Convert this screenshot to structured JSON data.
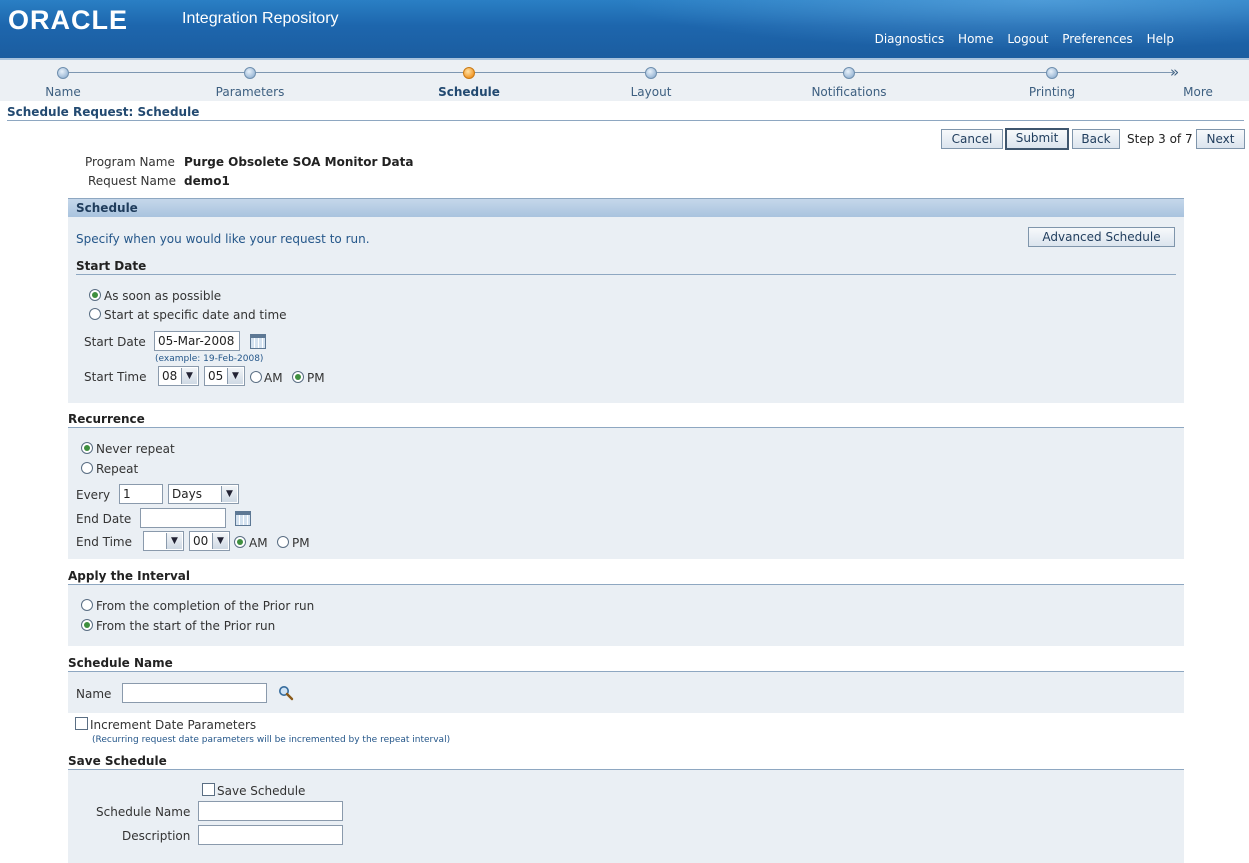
{
  "header": {
    "logo": "ORACLE",
    "app_title": "Integration Repository",
    "links": [
      "Diagnostics",
      "Home",
      "Logout",
      "Preferences",
      "Help"
    ]
  },
  "train": {
    "steps": [
      "Name",
      "Parameters",
      "Schedule",
      "Layout",
      "Notifications",
      "Printing",
      "More"
    ],
    "active": "Schedule"
  },
  "page_title": "Schedule Request: Schedule",
  "buttons": {
    "cancel": "Cancel",
    "submit": "Submit",
    "back": "Back",
    "step_text": "Step 3 of 7",
    "next": "Next",
    "advanced_schedule": "Advanced Schedule"
  },
  "request": {
    "program_name_label": "Program Name",
    "program_name": "Purge Obsolete SOA Monitor Data",
    "request_name_label": "Request Name",
    "request_name": "demo1"
  },
  "schedule": {
    "header": "Schedule",
    "instruction": "Specify when you would like your request to run.",
    "start_date_heading": "Start Date",
    "opt_asap": "As soon as possible",
    "opt_specific": "Start at specific date and time",
    "start_date_label": "Start Date",
    "start_date_value": "05-Mar-2008",
    "start_date_hint": "(example: 19-Feb-2008)",
    "start_time_label": "Start Time",
    "start_hour": "08",
    "start_minute": "05",
    "am": "AM",
    "pm": "PM"
  },
  "recurrence": {
    "heading": "Recurrence",
    "never": "Never repeat",
    "repeat": "Repeat",
    "every_label": "Every",
    "every_value": "1",
    "every_unit": "Days",
    "end_date_label": "End Date",
    "end_date_value": "",
    "end_time_label": "End Time",
    "end_hour": "",
    "end_minute": "00",
    "am": "AM",
    "pm": "PM"
  },
  "interval": {
    "heading": "Apply the Interval",
    "from_completion": "From the completion of the Prior run",
    "from_start": "From the start of the Prior run"
  },
  "schedule_name": {
    "heading": "Schedule Name",
    "name_label": "Name",
    "name_value": "",
    "increment_label": "Increment Date Parameters",
    "increment_hint": "(Recurring request date parameters will be incremented by the repeat interval)"
  },
  "save_schedule": {
    "heading": "Save Schedule",
    "save_label": "Save Schedule",
    "schedule_name_label": "Schedule Name",
    "schedule_name_value": "",
    "description_label": "Description",
    "description_value": ""
  }
}
